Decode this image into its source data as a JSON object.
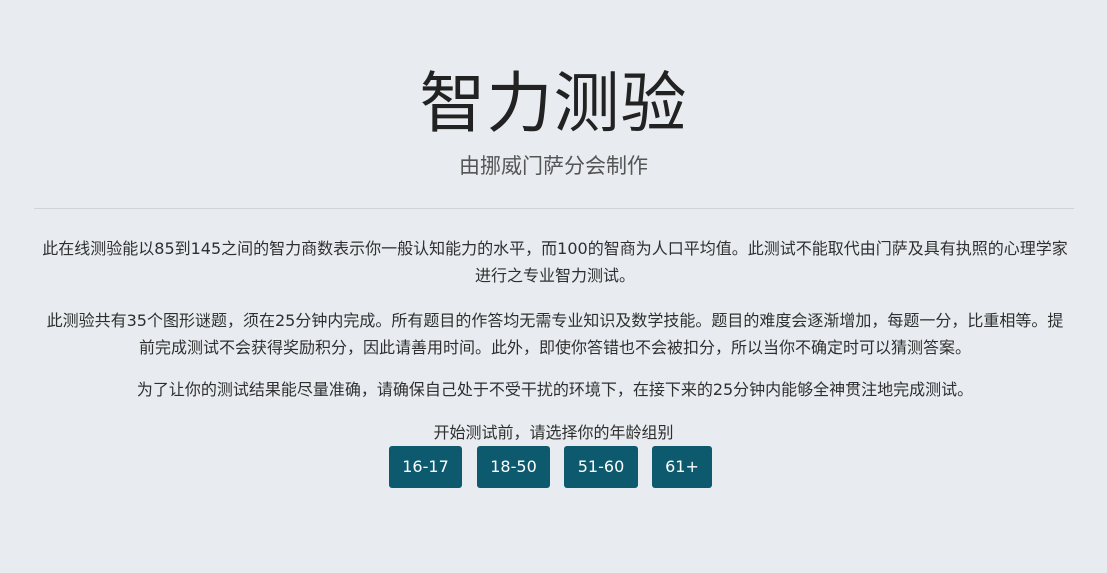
{
  "header": {
    "title": "智力测验",
    "subtitle": "由挪威门萨分会制作"
  },
  "intro": {
    "paragraph1": "此在线测验能以85到145之间的智力商数表示你一般认知能力的水平，而100的智商为人口平均值。此测试不能取代由门萨及具有执照的心理学家进行之专业智力测试。",
    "paragraph2": "此测验共有35个图形谜题，须在25分钟内完成。所有题目的作答均无需专业知识及数学技能。题目的难度会逐渐增加，每题一分，比重相等。提前完成测试不会获得奖励积分，因此请善用时间。此外，即使你答错也不会被扣分，所以当你不确定时可以猜测答案。",
    "paragraph3": "为了让你的测试结果能尽量准确，请确保自己处于不受干扰的环境下，在接下来的25分钟内能够全神贯注地完成测试。"
  },
  "age_selection": {
    "prompt": "开始测试前，请选择你的年龄组别",
    "options": [
      {
        "label": "16-17"
      },
      {
        "label": "18-50"
      },
      {
        "label": "51-60"
      },
      {
        "label": "61+"
      }
    ]
  },
  "colors": {
    "background": "#e8ecf0",
    "button": "#0d5a6e",
    "button_text": "#ffffff",
    "divider": "#cfd4d8"
  }
}
